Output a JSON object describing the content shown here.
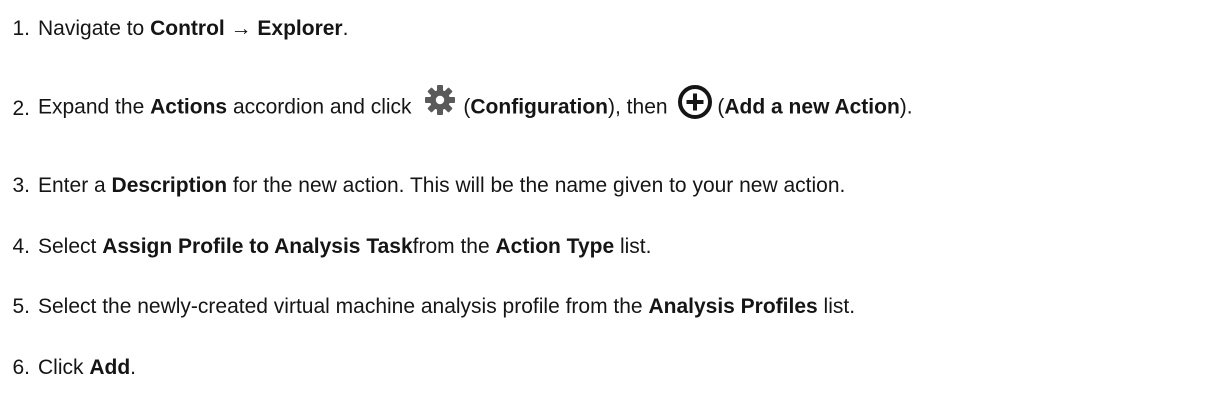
{
  "steps": [
    {
      "number": "1.",
      "parts": [
        "Navigate to ",
        "Control → Explorer",
        "."
      ]
    },
    {
      "number": "2.",
      "parts": [
        "Expand the ",
        "Actions",
        " accordion and click ",
        "(",
        "Configuration",
        "), then ",
        "(",
        "Add a new Action",
        ")."
      ]
    },
    {
      "number": "3.",
      "parts": [
        "Enter a ",
        "Description",
        " for the new action. This will be the name given to your new action."
      ]
    },
    {
      "number": "4.",
      "parts": [
        "Select ",
        "Assign Profile to Analysis Task",
        "from the ",
        "Action Type",
        " list."
      ]
    },
    {
      "number": "5.",
      "parts": [
        "Select the newly-created virtual machine analysis profile from the ",
        "Analysis Profiles",
        " list."
      ]
    },
    {
      "number": "6.",
      "parts": [
        "Click ",
        "Add",
        "."
      ]
    }
  ],
  "icons": {
    "configuration": "gear-icon",
    "add_action": "plus-circle-icon"
  },
  "colors": {
    "text": "#151515",
    "icon_gear": "#5a5a5a",
    "icon_plus": "#151515"
  }
}
